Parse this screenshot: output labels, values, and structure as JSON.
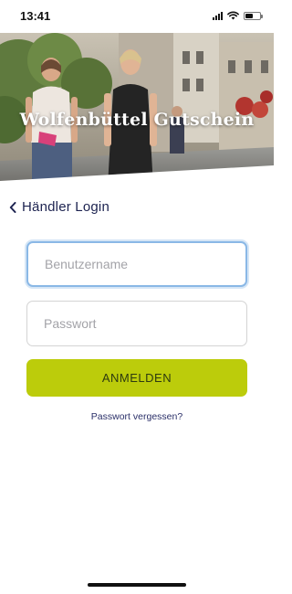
{
  "status_bar": {
    "time": "13:41",
    "battery_level": 0.5
  },
  "hero": {
    "title": "Wolfenbüttel Gutschein"
  },
  "nav": {
    "back_label": "Händler Login"
  },
  "form": {
    "username_placeholder": "Benutzername",
    "password_placeholder": "Passwort",
    "submit_label": "ANMELDEN",
    "forgot_label": "Passwort vergessen?"
  },
  "colors": {
    "accent": "#bccc0b",
    "text_dark": "#1d2350",
    "focus": "#8ab8e6"
  }
}
